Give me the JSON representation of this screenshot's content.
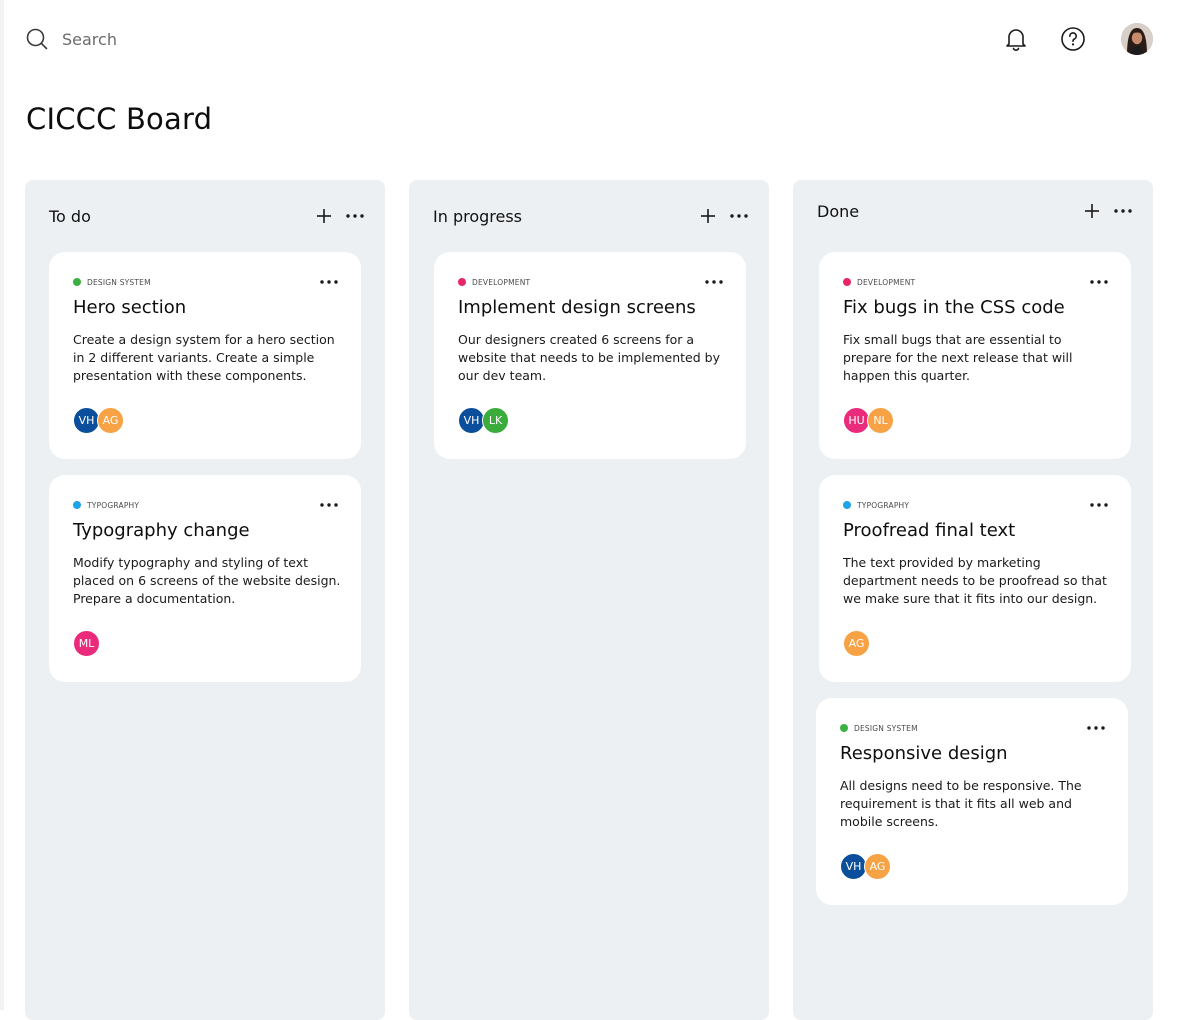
{
  "colors": {
    "column_bg": "#edf0f3",
    "card_bg": "#ffffff",
    "tag_design_system": "#3cb043",
    "tag_development": "#e8256b",
    "tag_typography": "#1ea4e9"
  },
  "header": {
    "search_placeholder": "Search",
    "icons": [
      "search-icon",
      "bell-icon",
      "help-icon",
      "user-avatar"
    ]
  },
  "board": {
    "title": "CICCC Board"
  },
  "columns": [
    {
      "title": "To do",
      "cards": [
        {
          "tag": "DESIGN SYSTEM",
          "tag_color": "#3cb043",
          "title": "Hero section",
          "description": "Create a design system for a hero section in 2 different variants. Create a simple presentation with these components.",
          "assignees": [
            {
              "initials": "VH",
              "color": "#0b4f9c"
            },
            {
              "initials": "AG",
              "color": "#f7a245"
            }
          ]
        },
        {
          "tag": "TYPOGRAPHY",
          "tag_color": "#1ea4e9",
          "title": "Typography change",
          "description": "Modify typography and styling of text placed on 6 screens of the website design. Prepare a documentation.",
          "assignees": [
            {
              "initials": "ML",
              "color": "#ea2a7a"
            }
          ]
        }
      ]
    },
    {
      "title": "In progress",
      "cards": [
        {
          "tag": "DEVELOPMENT",
          "tag_color": "#e8256b",
          "title": "Implement design screens",
          "description": "Our designers created 6 screens for a website that needs to be implemented by our dev team.",
          "assignees": [
            {
              "initials": "VH",
              "color": "#0b4f9c"
            },
            {
              "initials": "LK",
              "color": "#3bab3c"
            }
          ]
        }
      ]
    },
    {
      "title": "Done",
      "cards": [
        {
          "tag": "DEVELOPMENT",
          "tag_color": "#e8256b",
          "title": "Fix bugs in the CSS code",
          "description": "Fix small bugs that are essential to prepare for the next release that will happen this quarter.",
          "assignees": [
            {
              "initials": "HU",
              "color": "#ea2a7a"
            },
            {
              "initials": "NL",
              "color": "#f7a245"
            }
          ]
        },
        {
          "tag": "TYPOGRAPHY",
          "tag_color": "#1ea4e9",
          "title": "Proofread final text",
          "description": "The text provided by marketing department needs to be proofread so that we make sure that it fits into our design.",
          "assignees": [
            {
              "initials": "AG",
              "color": "#f7a245"
            }
          ]
        },
        {
          "tag": "DESIGN SYSTEM",
          "tag_color": "#3cb043",
          "title": "Responsive design",
          "description": "All designs need to be responsive. The requirement is that it fits all web and mobile screens.",
          "assignees": [
            {
              "initials": "VH",
              "color": "#0b4f9c"
            },
            {
              "initials": "AG",
              "color": "#f7a245"
            }
          ]
        }
      ]
    }
  ]
}
